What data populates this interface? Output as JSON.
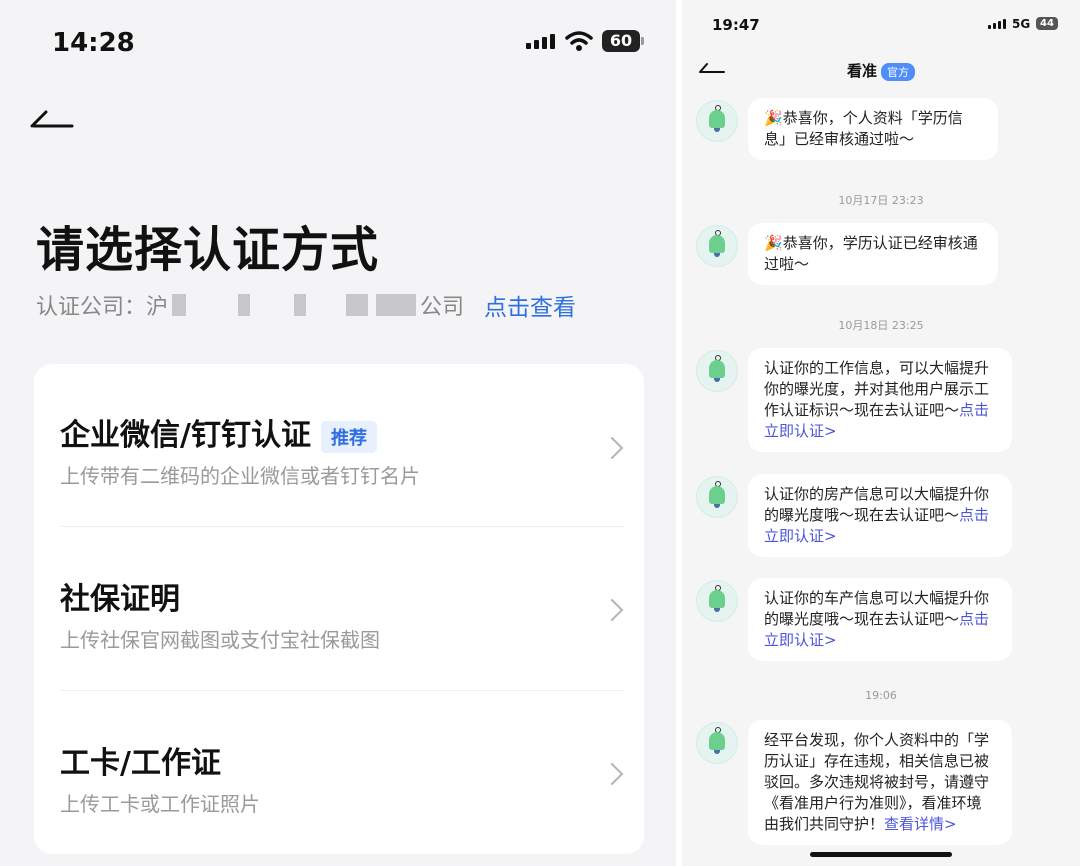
{
  "left": {
    "status": {
      "time": "14:28",
      "battery": "60"
    },
    "title": "请选择认证方式",
    "company": {
      "prefix": "认证公司：",
      "initial": "沪",
      "suffix": "公司",
      "link": "点击查看"
    },
    "options": [
      {
        "title": "企业微信/钉钉认证",
        "badge": "推荐",
        "subtitle": "上传带有二维码的企业微信或者钉钉名片"
      },
      {
        "title": "社保证明",
        "subtitle": "上传社保官网截图或支付宝社保截图"
      },
      {
        "title": "工卡/工作证",
        "subtitle": "上传工卡或工作证照片"
      }
    ]
  },
  "right": {
    "status": {
      "time": "19:47",
      "network": "5G",
      "battery": "44"
    },
    "nav": {
      "title": "看准",
      "badge": "官方"
    },
    "messages": [
      {
        "emoji": "🎉",
        "text": "恭喜你，个人资料「学历信息」已经审核通过啦～"
      },
      {
        "emoji": "🎉",
        "text": "恭喜你，学历认证已经审核通过啦～"
      },
      {
        "text": "认证你的工作信息，可以大幅提升你的曝光度，并对其他用户展示工作认证标识～现在去认证吧～",
        "link": "点击立即认证>"
      },
      {
        "text": "认证你的房产信息可以大幅提升你的曝光度哦～现在去认证吧～",
        "link": "点击立即认证>"
      },
      {
        "text": "认证你的车产信息可以大幅提升你的曝光度哦～现在去认证吧～",
        "link": "点击立即认证>"
      },
      {
        "text": "经平台发现，你个人资料中的「学历认证」存在违规，相关信息已被驳回。多次违规将被封号，请遵守《看准用户行为准则》，看准环境由我们共同守护！",
        "link": "查看详情>"
      }
    ],
    "timestamps": [
      "10月17日 23:23",
      "10月18日 23:25",
      "19:06"
    ]
  },
  "colors": {
    "link": "#2f6fe0",
    "chat_link": "#4b55d8",
    "badge": "#4f8ef7"
  }
}
